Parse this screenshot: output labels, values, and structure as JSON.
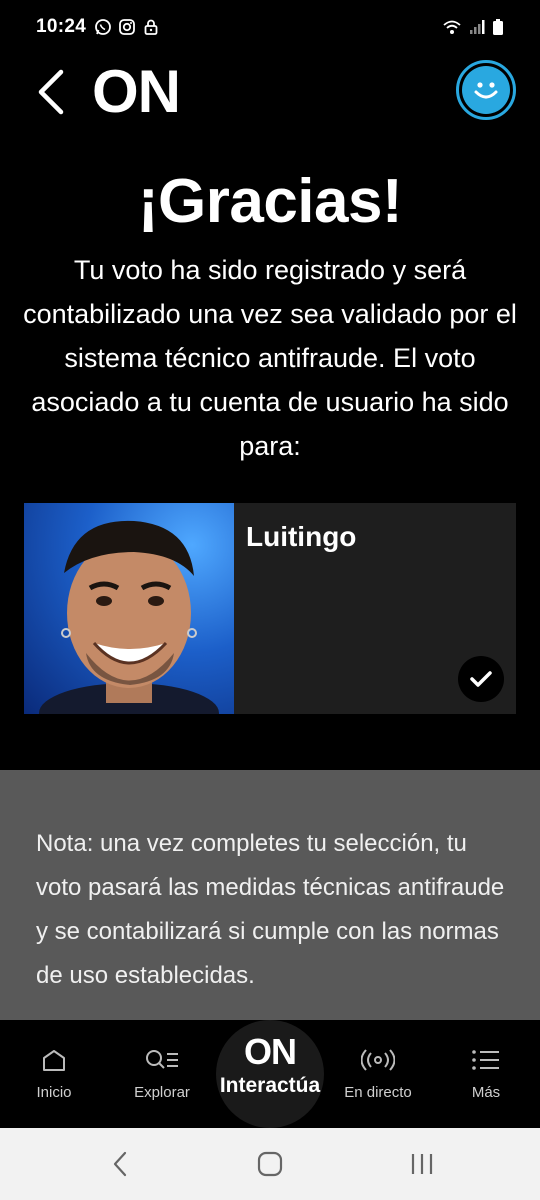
{
  "status_bar": {
    "time": "10:24"
  },
  "header": {
    "logo": "ON"
  },
  "thanks": {
    "title": "¡Gracias!",
    "message": "Tu voto ha sido registrado y será contabilizado una vez sea validado por el sistema técnico antifraude. El voto asociado a tu cuenta de usuario ha sido para:"
  },
  "vote": {
    "candidate_name": "Luitingo"
  },
  "note": {
    "text": "Nota: una vez completes tu selección, tu voto pasará las medidas técnicas antifraude y se contabilizará si cumple con las normas de uso establecidas."
  },
  "bottom_nav": {
    "items": [
      {
        "label": "Inicio",
        "icon": "home-icon"
      },
      {
        "label": "Explorar",
        "icon": "search-list-icon"
      },
      {
        "label": "Interactúa",
        "icon": "on-logo-icon",
        "logo": "ON"
      },
      {
        "label": "En directo",
        "icon": "live-broadcast-icon"
      },
      {
        "label": "Más",
        "icon": "menu-list-icon"
      }
    ]
  },
  "colors": {
    "background": "#000000",
    "accent": "#29a8e0",
    "card": "#1e1e1e",
    "note_bg": "#595959",
    "system_nav_bg": "#f2f2f2"
  }
}
